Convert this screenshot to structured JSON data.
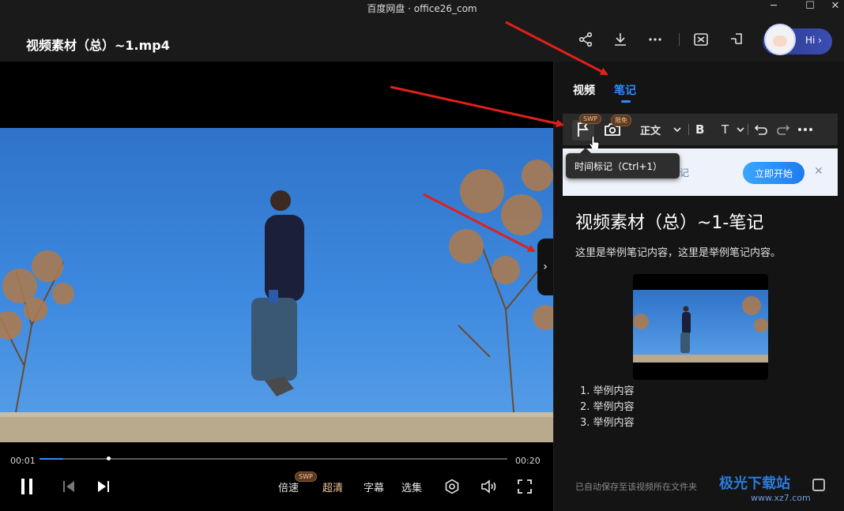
{
  "window": {
    "title": "百度网盘 · office26_com",
    "controls": [
      "─",
      "☐",
      "✕"
    ]
  },
  "header": {
    "video_title": "视频素材（总）~1.mp4",
    "icons": [
      "share-icon",
      "download-icon",
      "more-icon",
      "screen-capture-icon",
      "pin-icon"
    ],
    "hi_label": "Hi ›"
  },
  "player": {
    "current_time": "00:01",
    "total_time": "00:20",
    "progress": 0.05,
    "speed_label": "倍速",
    "speed_badge": "SWP",
    "quality_label": "超清",
    "subtitle_label": "字幕",
    "episodes_label": "选集",
    "side_toggle": "›"
  },
  "panel": {
    "tabs": [
      {
        "label": "视频",
        "active": false
      },
      {
        "label": "笔记",
        "active": true
      }
    ],
    "toolbar": {
      "flag_badge": "SWP",
      "screenshot_badge": "限免",
      "text_style": "正文",
      "bold": "B",
      "font_size": "T"
    },
    "tooltip": "时间标记（Ctrl+1）",
    "promo": {
      "text": "网盘智能笔记",
      "button": "立即开始",
      "close": "✕"
    },
    "note": {
      "title": "视频素材（总）~1-笔记",
      "body": "这里是举例笔记内容，这里是举例笔记内容。",
      "list": [
        "1. 举例内容",
        "2. 举例内容",
        "3. 举例内容"
      ]
    },
    "autosave": "已自动保存至该视频所在文件夹"
  },
  "watermark": {
    "text": "极光下载站",
    "sub": "www.xz7.com"
  },
  "colors": {
    "accent": "#2f8cff",
    "annotation": "#e0201a",
    "background": "#141414"
  }
}
